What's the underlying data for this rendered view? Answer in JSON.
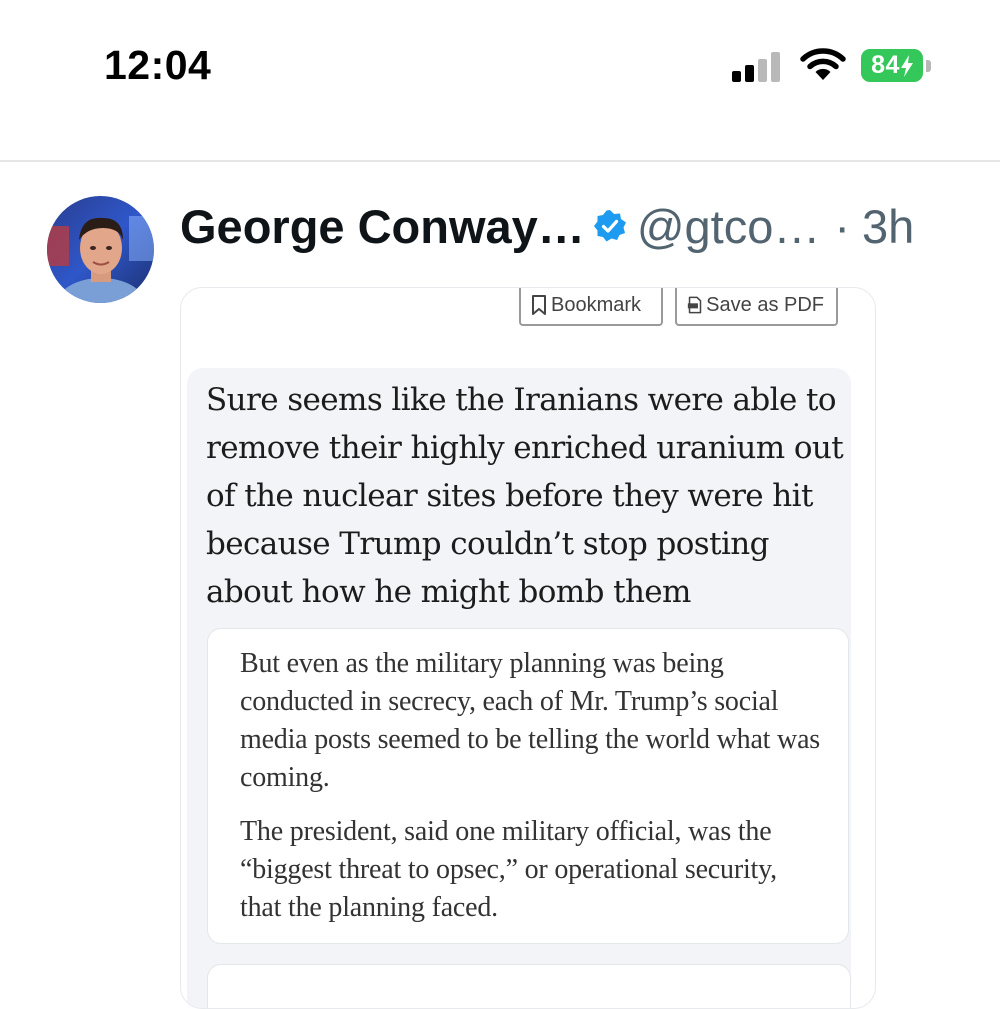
{
  "status_bar": {
    "time": "12:04",
    "battery_level": "84",
    "battery_charging": true,
    "signal_bars_active": 2,
    "signal_bars_total": 4,
    "colors": {
      "battery": "#34c759"
    }
  },
  "post": {
    "author_name": "George Conway…",
    "verified": true,
    "handle": "@gtco…",
    "separator": "·",
    "time_ago": "3h",
    "avatar_icon": "avatar-photo"
  },
  "media": {
    "toolbar": {
      "bookmark_label": "Bookmark",
      "save_pdf_label": "Save as PDF"
    },
    "quoted_post_text": "Sure seems like the Iranians were able to remove their highly enriched uranium out of the nuclear sites before they were hit because Trump couldn’t stop posting about how he might bomb them",
    "article_excerpt": {
      "paragraphs": [
        "But even as the military planning was being conducted in secrecy, each of Mr. Trump’s social media posts seemed to be telling the world what was coming.",
        "The president, said one military official, was the “biggest threat to opsec,” or operational security, that the planning faced."
      ]
    }
  },
  "colors": {
    "verified_badge": "#1d9bf0",
    "secondary_text": "#536471",
    "card_background": "#f2f4f7"
  }
}
